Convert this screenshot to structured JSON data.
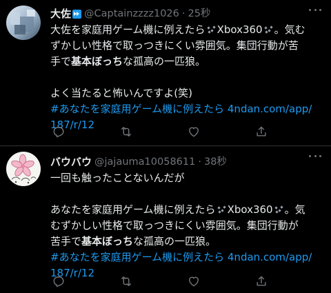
{
  "tweets": [
    {
      "display_name": "大佐",
      "badge": "bot-label-icon",
      "handle": "@Captainzzzz1026",
      "separator": "·",
      "time": "25秒",
      "lines": [
        {
          "a": "大佐を家庭用ゲーム機に例えたら",
          "b": "Xbox360",
          "c": "。気む"
        },
        {
          "t": "ずかしい性格で取っつきにくい雰囲気。集団行動が苦"
        },
        {
          "a": "手で",
          "bold": "基本ぼっち",
          "c": "な孤高の一匹狼。"
        },
        {
          "t": ""
        },
        {
          "t": "よく当たると怖いんですよ(笑)"
        },
        {
          "link": "#あなたを家庭用ゲーム機に例えたら 4ndan.com/app/"
        },
        {
          "link": "187/r/12"
        }
      ]
    },
    {
      "display_name": "バウバウ",
      "handle": "@jajauma10058611",
      "separator": "·",
      "time": "38秒",
      "lines": [
        {
          "t": "一回も触ったことないんだが"
        },
        {
          "t": ""
        },
        {
          "a": "あなたを家庭用ゲーム機に例えたら",
          "b": "Xbox360",
          "c": "。気"
        },
        {
          "t": "むずかしい性格で取っつきにくい雰囲気。集団行動が"
        },
        {
          "a": "苦手で",
          "bold": "基本ぼっち",
          "c": "な孤高の一匹狼。"
        },
        {
          "link": "#あなたを家庭用ゲーム機に例えたら 4ndan.com/app/"
        },
        {
          "link": "187/r/12"
        }
      ]
    }
  ],
  "icons": {
    "more": "more-horizontal-icon",
    "reply": "reply-icon",
    "retweet": "retweet-icon",
    "like": "heart-icon",
    "share": "share-icon",
    "sparkles": "sparkles-icon"
  },
  "colors": {
    "background": "#000000",
    "text": "#e7e9ea",
    "secondary": "#71767b",
    "link": "#1d9bf0",
    "divider": "#2f3336"
  }
}
